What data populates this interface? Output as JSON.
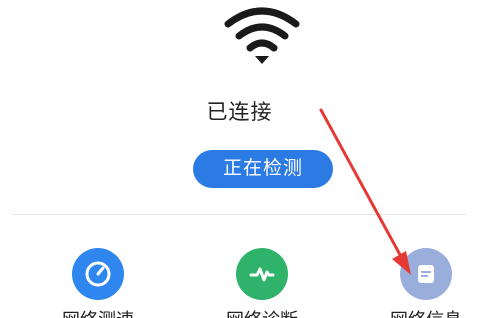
{
  "connection": {
    "status": "已连接",
    "action_label": "正在检测"
  },
  "tools": [
    {
      "label": "网络测速",
      "icon": "speedometer-icon",
      "color": "#2f86ee"
    },
    {
      "label": "网络诊断",
      "icon": "pulse-icon",
      "color": "#2fb36a"
    },
    {
      "label": "网络信息",
      "icon": "document-icon",
      "color": "#9aaedb"
    }
  ],
  "colors": {
    "accent": "#2c7be5",
    "annotation_arrow": "#e53935"
  }
}
